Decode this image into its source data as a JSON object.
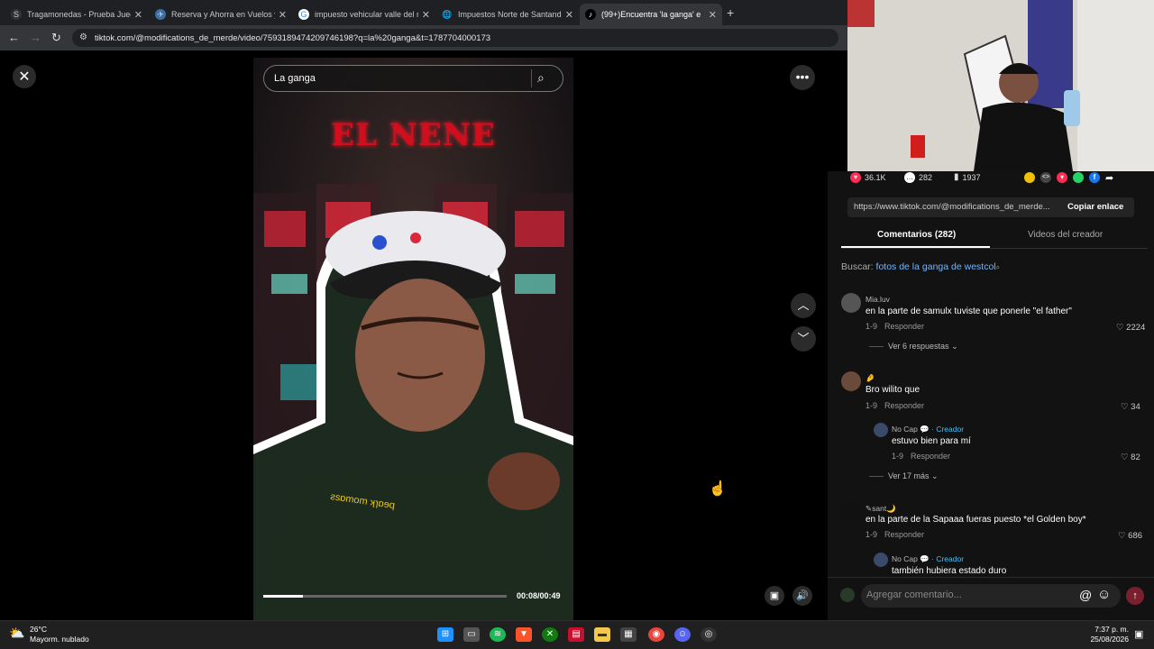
{
  "browser": {
    "tabs": [
      {
        "icon": "S",
        "title": "Tragamonedas - Prueba Juegos",
        "active": false
      },
      {
        "icon": "✈",
        "title": "Reserva y Ahorra en Vuelos y H",
        "active": false
      },
      {
        "icon": "G",
        "title": "impuesto vehicular valle del ro",
        "active": false
      },
      {
        "icon": "🌐",
        "title": "Impuestos Norte de Santander",
        "active": false
      },
      {
        "icon": "♪",
        "title": "(99+)Encuentra 'la ganga' e",
        "active": true
      }
    ],
    "new_tab_symbol": "+",
    "url": "tiktok.com/@modifications_de_merde/video/7593189474209746198?q=la%20ganga&t=1787704000173"
  },
  "video": {
    "search_value": "La ganga",
    "neon_text": "EL NENE",
    "time": "00:08/00:49",
    "progress": 0.163
  },
  "panel": {
    "likes": "36.1K",
    "comments_count": "282",
    "saves": "1937",
    "link": "https://www.tiktok.com/@modifications_de_merde...",
    "copy_label": "Copiar enlace",
    "tab_comments": "Comentarios (282)",
    "tab_creator": "Videos del creador",
    "buscar_label": "Buscar:",
    "buscar_query": "fotos de la ganga de westcol",
    "comments": [
      {
        "name": "Mia.luv",
        "text": "en la parte de samulx tuviste que ponerle \"el father\"",
        "date": "1-9",
        "reply": "Responder",
        "likes": "2224",
        "more": "Ver 6 respuestas"
      },
      {
        "name": "🤌",
        "text": "Bro wilito que",
        "date": "1-9",
        "reply": "Responder",
        "likes": "34"
      },
      {
        "name": "No Cap 💬",
        "creator": "· Creador",
        "text": "estuvo bien para mí",
        "date": "1-9",
        "reply": "Responder",
        "likes": "82",
        "more": "Ver 17 más"
      },
      {
        "name": "✎sant🌙",
        "text": "en la parte de la Sapaaa fueras puesto *el Golden boy*",
        "date": "1-9",
        "reply": "Responder",
        "likes": "686"
      },
      {
        "name": "No Cap 💬",
        "creator": "· Creador",
        "text": "también hubiera estado duro"
      }
    ],
    "composer_placeholder": "Agregar comentario..."
  },
  "taskbar": {
    "temp": "26°C",
    "weather": "Mayorm. nublado",
    "time": "7:37 p. m.",
    "date": "25/08/2026"
  },
  "colors": {
    "accent": "#fe2c55",
    "link": "#74b5ff",
    "creator": "#3ec1ff"
  }
}
